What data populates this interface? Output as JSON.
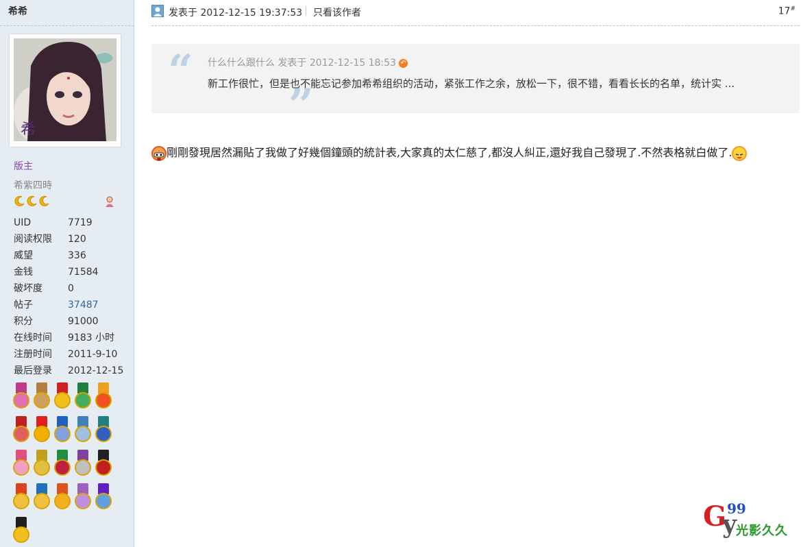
{
  "author": {
    "name": "希希",
    "group": "版主",
    "title": "希紫四時",
    "star_count": 3
  },
  "stats": [
    {
      "label": "UID",
      "value": "7719"
    },
    {
      "label": "阅读权限",
      "value": "120"
    },
    {
      "label": "威望",
      "value": "336"
    },
    {
      "label": "金钱",
      "value": "71584"
    },
    {
      "label": "破坏度",
      "value": "0"
    },
    {
      "label": "帖子",
      "value": "37487"
    },
    {
      "label": "积分",
      "value": "91000"
    },
    {
      "label": "在线时间",
      "value": "9183 小时"
    },
    {
      "label": "注册时间",
      "value": "2011-9-10"
    },
    {
      "label": "最后登录",
      "value": "2012-12-15"
    }
  ],
  "medal_count": 21,
  "post": {
    "time": "发表于 2012-12-15 19:37:53",
    "author_only": "只看该作者",
    "floor": "17",
    "floor_suffix": "#",
    "quote_meta": "什么什么跟什么 发表于 2012-12-15 18:53",
    "quote_text": "新工作很忙，但是也不能忘记参加希希组织的活动，紧张工作之余，放松一下，很不错，看看长长的名单，统计实 ...",
    "body_text_1": "剛剛發現居然漏貼了我做了好幾個鐘頭的統計表,大家真的太仁慈了,都沒人糾正,還好我自己發現了.不然表格就白做了.",
    "body_text_2": ""
  },
  "watermark": {
    "letters": "G",
    "letters2": "y",
    "number": "99",
    "text": "光影久久"
  },
  "colors": {
    "sidebar_bg": "#e5edf2",
    "group_admin": "#8844aa",
    "link": "#369",
    "quote_bg": "#f3f3f3"
  }
}
